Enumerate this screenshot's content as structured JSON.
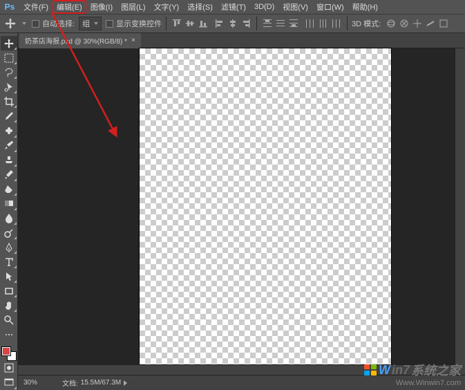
{
  "menubar": {
    "logo": "Ps",
    "items": [
      "文件(F)",
      "编辑(E)",
      "图像(I)",
      "图层(L)",
      "文字(Y)",
      "选择(S)",
      "滤镜(T)",
      "3D(D)",
      "视图(V)",
      "窗口(W)",
      "帮助(H)"
    ],
    "highlighted_index": 1
  },
  "options": {
    "auto_select_label": "自动选择:",
    "group_label": "组",
    "show_transform_label": "显示变换控件",
    "mode_label": "3D 模式:"
  },
  "tab": {
    "title": "奶茶店海报.psd @ 30%(RGB/8) *",
    "close": "×"
  },
  "tools_list": [
    "move-tool",
    "artboard-tool",
    "marquee-tool",
    "lasso-tool",
    "quick-select-tool",
    "crop-tool",
    "eyedropper-tool",
    "spot-heal-tool",
    "brush-tool",
    "clone-stamp-tool",
    "history-brush-tool",
    "eraser-tool",
    "gradient-tool",
    "blur-tool",
    "dodge-tool",
    "pen-tool",
    "type-tool",
    "path-select-tool",
    "rectangle-tool",
    "hand-tool",
    "zoom-tool"
  ],
  "status": {
    "zoom": "30%",
    "docinfo_label": "文档:",
    "docinfo_value": "15.5M/67.3M"
  },
  "colors": {
    "foreground": "#d64545",
    "background": "#ffffff"
  },
  "watermark": {
    "line1_a": "W",
    "line1_b": "in7",
    "line1_c": "系统之家",
    "line2": "Www.Winwin7.com"
  }
}
